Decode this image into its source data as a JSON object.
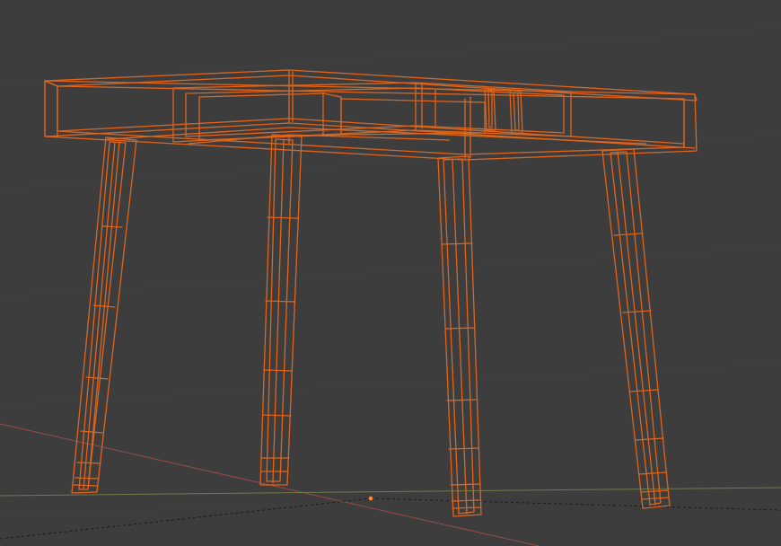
{
  "viewport": {
    "mode": "wireframe",
    "shading": "wireframe"
  },
  "colors": {
    "background": "#3d3d3d",
    "grid": "#444444",
    "selection_wire": "#e0651c",
    "selection_wire_dim": "#b8501a",
    "axis_x": "#9a4a4a",
    "axis_y": "#6f7a4a",
    "origin_dot": "#ff8a3a"
  },
  "scene": {
    "object": {
      "kind": "table",
      "parts": [
        "tabletop",
        "drawer",
        "leg-front-left",
        "leg-front-right",
        "leg-back-left",
        "leg-back-right"
      ],
      "selected": true
    }
  }
}
